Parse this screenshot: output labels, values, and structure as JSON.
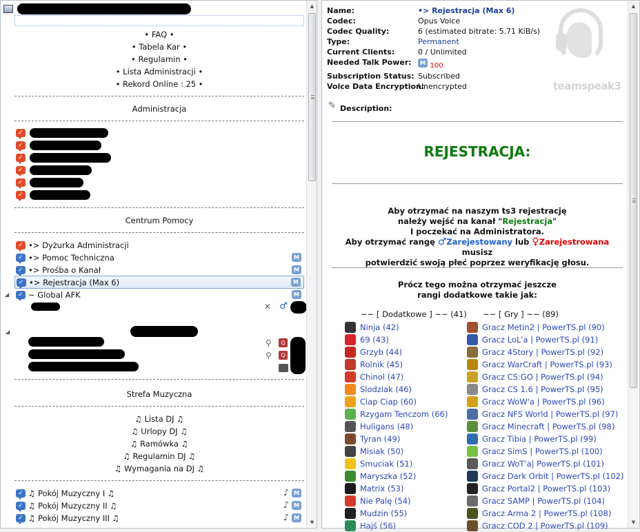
{
  "tree": {
    "server_icon": "server-icon",
    "top_info": [
      "• FAQ •",
      "• Tabela Kar •",
      "• Regulamin •",
      "• Lista Administracji •",
      "• Rekord Online : 25 •"
    ],
    "administracja": "Administracja",
    "centrum_pomocy": "Centrum Pomocy",
    "help_channels": [
      {
        "label": "•> Dyżurka Administracji"
      },
      {
        "label": "•> Pomoc Techniczna"
      },
      {
        "label": "•> Prośba o Kanał"
      },
      {
        "label": "•> Rejestracja (Max 6)"
      }
    ],
    "global_afk": "~ Global AFK",
    "strefa_muzyczna": "Strefa Muzyczna",
    "music_info": [
      "♫ Lista DJ ♫",
      "♫ Urlopy DJ ♫",
      "♫ Ramówka ♫",
      "♫ Regulamin DJ ♫",
      "♫ Wymagania na DJ ♫"
    ],
    "music_rooms": [
      "♫ Pokój Muzyczny I ♫",
      "♫ Pokój Muzyczny II ♫",
      "♫ Pokój Muzyczny III ♫"
    ],
    "badge_letter": "M"
  },
  "info": {
    "labels": {
      "name": "Name:",
      "codec": "Codec:",
      "quality": "Codec Quality:",
      "type": "Type:",
      "clients": "Current Clients:",
      "talk": "Needed Talk Power:",
      "sub": "Subscription Status:",
      "enc": "Voice Data Encryption:",
      "desc": "Description:"
    },
    "name": "•> Rejestracja (Max 6)",
    "codec": "Opus Voice",
    "quality": "6 (estimated bitrate: 5.71 KiB/s)",
    "type": "Permanent",
    "clients": "0 / Unlimited",
    "talk_power": "100",
    "sub": "Subscribed",
    "enc": "Unencrypted",
    "logo_text": "teamspeak3"
  },
  "description": {
    "heading": "REJESTRACJA:",
    "p1_a": "Aby otrzymać na naszym ts3 rejestrację",
    "p1_b_pre": "należy wejść na kanał \"",
    "p1_b_link": "Rejestracja",
    "p1_b_post": "\"",
    "p1_c": "I poczekać na Administratora.",
    "p2_pre": "Aby otrzymać rangę ",
    "male_symbol": "♂",
    "male": "Zarejestowany",
    "lub": " lub ",
    "female_symbol": "♀",
    "female": "Zarejestrowana",
    "p2_post": " musisz",
    "p2_b": "potwierdzić swoją płeć poprzez weryfikację głosu.",
    "p3_a": "Prócz tego można otrzymać jeszcze",
    "p3_b": "rangi dodatkowe takie jak:",
    "col1_head": "~~ [ Dodatkowe ] ~~ (41)",
    "col2_head": "~~ [ Gry ] ~~ (89)",
    "col1": [
      {
        "label": "Ninja (42)",
        "color": "#333333"
      },
      {
        "label": "69 (43)",
        "color": "#d9242a"
      },
      {
        "label": "Grzyb (44)",
        "color": "#c8281f"
      },
      {
        "label": "Rolnik (45)",
        "color": "#c0392b"
      },
      {
        "label": "Chinol (47)",
        "color": "#d43a2a"
      },
      {
        "label": "Slodziak (46)",
        "color": "#f08a1c"
      },
      {
        "label": "Ciap Ciap (60)",
        "color": "#f2a21a"
      },
      {
        "label": "Rzygam Tenczom (66)",
        "color": "#5bb24c"
      },
      {
        "label": "Huligans (48)",
        "color": "#555555"
      },
      {
        "label": "Tyran (49)",
        "color": "#7a4a2a"
      },
      {
        "label": "Misiak (50)",
        "color": "#444444"
      },
      {
        "label": "Smuciak (51)",
        "color": "#f2c21a"
      },
      {
        "label": "Maryszka (52)",
        "color": "#3c8a2e"
      },
      {
        "label": "Matrix (53)",
        "color": "#1a1a1a"
      },
      {
        "label": "Nie Palę (54)",
        "color": "#d43a2a"
      },
      {
        "label": "Mudzin (55)",
        "color": "#222222"
      },
      {
        "label": "Hajś (56)",
        "color": "#2e8b57"
      }
    ],
    "col2": [
      {
        "label": "Gracz Metin2 | PowerTS.pl (90)",
        "color": "#a0522d"
      },
      {
        "label": "Gracz LoL'a | PowerTS.pl (91)",
        "color": "#3558a8"
      },
      {
        "label": "Gracz 4Story | PowerTS.pl (92)",
        "color": "#8a6d3b"
      },
      {
        "label": "Gracz WarCraft | PowerTS.pl (93)",
        "color": "#b8860b"
      },
      {
        "label": "Gracz CS:GO | PowerTS.pl (94)",
        "color": "#c9a227"
      },
      {
        "label": "Gracz CS 1.6 | PowerTS.pl (95)",
        "color": "#8a8a8a"
      },
      {
        "label": "Gracz WoW'a | PowerTS.pl (96)",
        "color": "#d4a017"
      },
      {
        "label": "Gracz NFS World | PowerTS.pl (97)",
        "color": "#4a6fa5"
      },
      {
        "label": "Gracz Minecraft | PowerTS.pl (98)",
        "color": "#5a8f3a"
      },
      {
        "label": "Gracz Tibia | PowerTS.pl (99)",
        "color": "#2f6fb0"
      },
      {
        "label": "Gracz SimS | PowerTS.pl (100)",
        "color": "#7ac143"
      },
      {
        "label": "Gracz WoT'a| PowerTS.pl (101)",
        "color": "#5a5a5a"
      },
      {
        "label": "Gracz Dark Orbit | PowerTS.pl (102)",
        "color": "#1f3a5a"
      },
      {
        "label": "Gracz Portal2 | PowerTS.pl (103)",
        "color": "#222222"
      },
      {
        "label": "Gracz SAMP | PowerTS.pl (104)",
        "color": "#6b6b6b"
      },
      {
        "label": "Gracz Arma 2 | PowerTS.pl (108)",
        "color": "#4b5320"
      },
      {
        "label": "Gracz COD 2 | PowerTS.pl (109)",
        "color": "#6b4f2a"
      }
    ]
  }
}
